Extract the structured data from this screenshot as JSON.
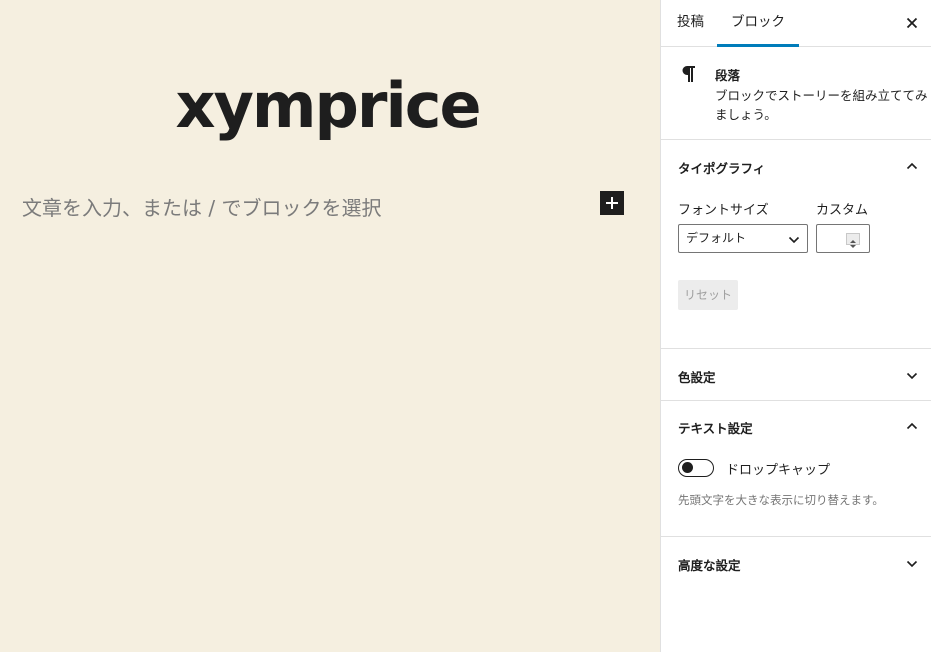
{
  "editor": {
    "title": "xymprice",
    "paragraph_placeholder": "文章を入力、または / でブロックを選択",
    "inserter_icon": "plus-icon"
  },
  "sidebar": {
    "tabs": [
      {
        "label": "投稿",
        "active": false
      },
      {
        "label": "ブロック",
        "active": true
      }
    ],
    "close_icon": "close-icon",
    "block": {
      "icon": "paragraph-icon",
      "name": "段落",
      "description": "ブロックでストーリーを組み立ててみましょう。"
    },
    "typography": {
      "title": "タイポグラフィ",
      "expanded": true,
      "font_size_label": "フォントサイズ",
      "font_size_value": "デフォルト",
      "custom_label": "カスタム",
      "custom_value": "",
      "reset_label": "リセット"
    },
    "color": {
      "title": "色設定",
      "expanded": false
    },
    "text": {
      "title": "テキスト設定",
      "expanded": true,
      "drop_cap_label": "ドロップキャップ",
      "drop_cap_on": false,
      "help": "先頭文字を大きな表示に切り替えます。"
    },
    "advanced": {
      "title": "高度な設定",
      "expanded": false
    }
  },
  "colors": {
    "canvas_bg": "#f5efe0",
    "accent": "#007cba",
    "text": "#1e1e1e"
  }
}
